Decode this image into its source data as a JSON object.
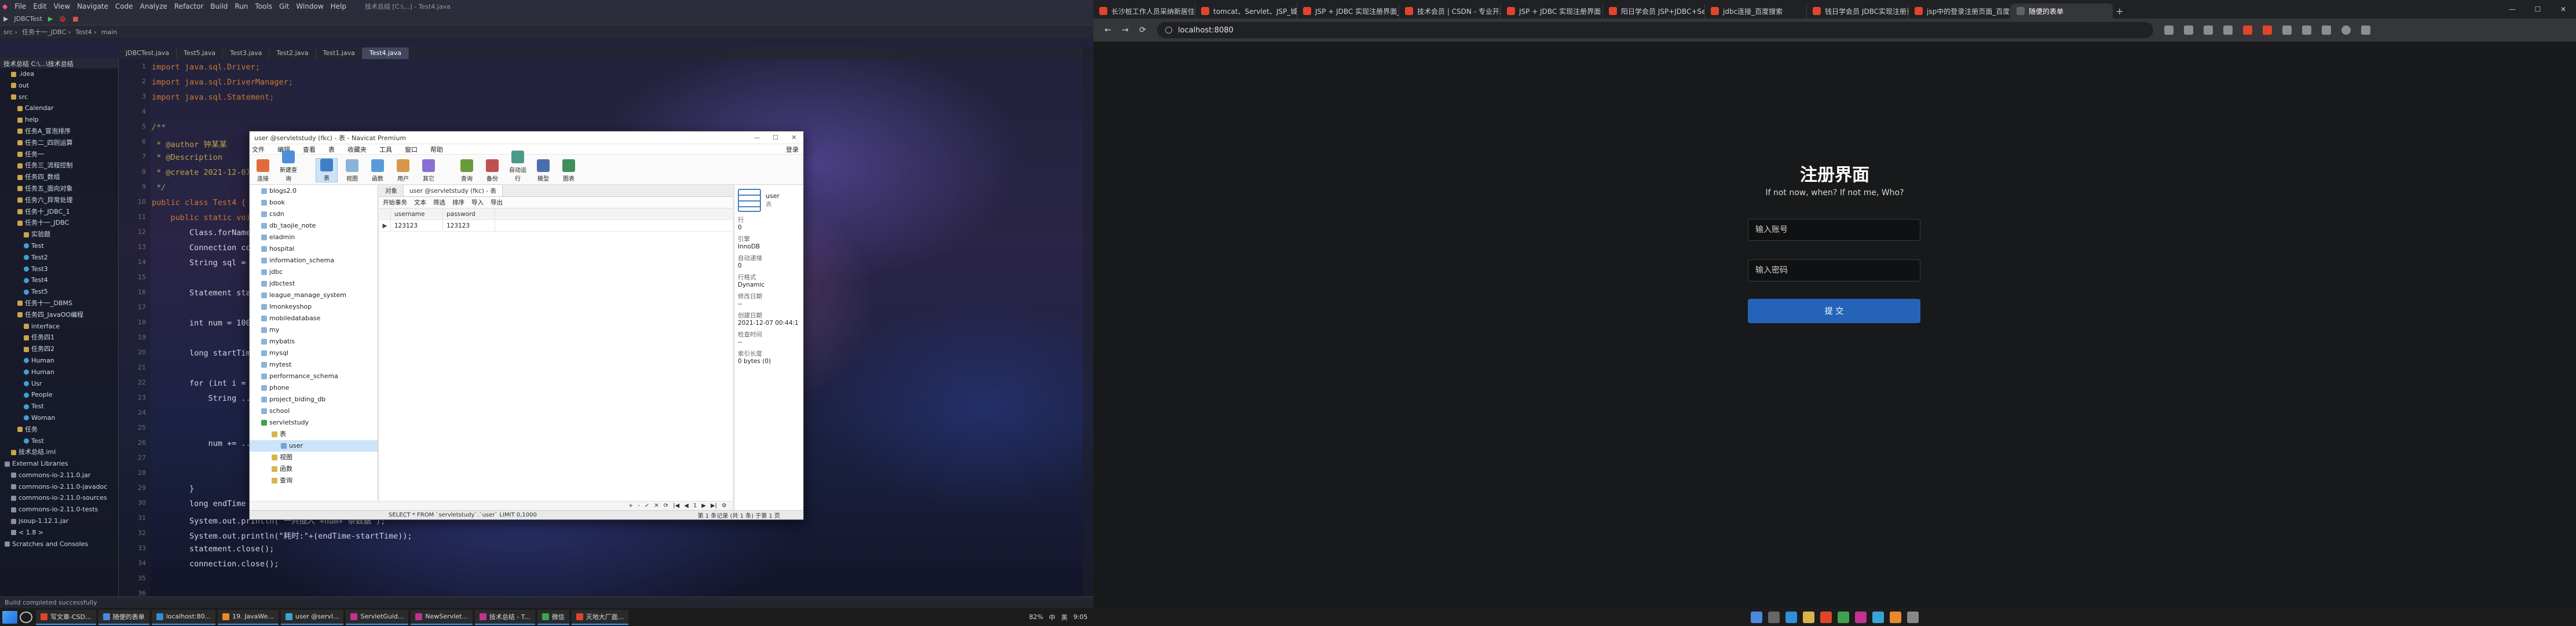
{
  "ide": {
    "menu": [
      "File",
      "Edit",
      "View",
      "Navigate",
      "Code",
      "Analyze",
      "Refactor",
      "Build",
      "Run",
      "Tools",
      "Git",
      "Window",
      "Help"
    ],
    "title": "技术总结 [C:\\...] - Test4.java",
    "toolbar_config": "JDBCTest",
    "breadcrumbs": [
      "src",
      "任务十一_JDBC",
      "Test4",
      "main"
    ],
    "editor_tabs": [
      "JDBCTest.java",
      "Test5.java",
      "Test3.java",
      "Test2.java",
      "Test1.java",
      "Test4.java"
    ],
    "active_tab": 5,
    "project_header": "技术总结 C:\\...\\技术总结",
    "tree": [
      ".idea",
      "out",
      "src",
      "Calendar",
      "help",
      "任务A_冒泡排序",
      "任务二_四则运算",
      "任务一",
      "任务三_流程控制",
      "任务四_数组",
      "任务五_面向对象",
      "任务六_异常处理",
      "任务十_JDBC_1",
      "任务十一_JDBC",
      "实验题",
      "Test",
      "Test2",
      "Test3",
      "Test4",
      "Test5",
      "任务十一_DBMS",
      "任务四_JavaOO编程",
      "interface",
      "任务四1",
      "任务四2",
      "Human",
      "Human",
      "Usr",
      "People",
      "Test",
      "Woman",
      "任务",
      "Test",
      "技术总结.iml",
      "External Libraries",
      "commons-io-2.11.0.jar",
      "commons-io-2.11.0-javadoc",
      "commons-io-2.11.0-sources",
      "commons-io-2.11.0-tests",
      "jsoup-1.12.1.jar",
      "< 1.8 >",
      "Scratches and Consoles"
    ],
    "code": [
      {
        "line": 1,
        "text": "import java.sql.Driver;"
      },
      {
        "line": 2,
        "text": "import java.sql.DriverManager;"
      },
      {
        "line": 3,
        "text": "import java.sql.Statement;"
      },
      {
        "line": 5,
        "text": "/**"
      },
      {
        "line": 6,
        "text": " * @author 钟某某"
      },
      {
        "line": 7,
        "text": " * @Description"
      },
      {
        "line": 8,
        "text": " * @create 2021-12-07"
      },
      {
        "line": 9,
        "text": " */"
      },
      {
        "line": 10,
        "text": "public class Test4 {"
      },
      {
        "line": 11,
        "text": "    public static void main(String[] args) throws Exception {"
      },
      {
        "line": 12,
        "text": "        Class.forName(\"com.mysql.cj.jdbc.Driver\");"
      },
      {
        "line": 13,
        "text": "        Connection connection = DriverManager.getConnection(url, user, password);"
      },
      {
        "line": 14,
        "text": "        String sql = \"...\";"
      },
      {
        "line": 16,
        "text": "        Statement statement = connection.createStatement();"
      },
      {
        "line": 18,
        "text": "        int num = 10000;"
      },
      {
        "line": 20,
        "text": "        long startTime = System.currentTimeMillis();"
      },
      {
        "line": 22,
        "text": "        for (int i = 0; i < num; i++) {"
      },
      {
        "line": 23,
        "text": "            String ..."
      },
      {
        "line": 26,
        "text": "            num += ..."
      },
      {
        "line": 29,
        "text": "        }"
      },
      {
        "line": 30,
        "text": "        long endTime = System.currentTimeMillis();"
      },
      {
        "line": 31,
        "text": "        System.out.println(\"一共插入\"+num+\"条数据\");"
      },
      {
        "line": 32,
        "text": "        System.out.println(\"耗时:\"+(endTime-startTime));"
      },
      {
        "line": 33,
        "text": "        statement.close();"
      },
      {
        "line": 34,
        "text": "        connection.close();"
      }
    ],
    "gutter_numbers": [
      "1",
      "2",
      "3",
      "4",
      "5",
      "6",
      "7",
      "8",
      "9",
      "10",
      "11",
      "12",
      "13",
      "14",
      "15",
      "16",
      "17",
      "18",
      "19",
      "20",
      "21",
      "22",
      "23",
      "24",
      "25",
      "26",
      "27",
      "28",
      "29",
      "30",
      "31",
      "32",
      "33",
      "34",
      "35",
      "36"
    ],
    "status": "Build completed successfully"
  },
  "navicat": {
    "title": "user @servletstudy (fkc) - 表 - Navicat Premium",
    "menu": [
      "文件",
      "编辑",
      "查看",
      "表",
      "收藏夹",
      "工具",
      "窗口",
      "帮助"
    ],
    "login_label": "登录",
    "ribbon": [
      "连接",
      "新建查询",
      "表",
      "视图",
      "函数",
      "用户",
      "其它",
      "查询",
      "备份",
      "自动运行",
      "模型",
      "图表"
    ],
    "selected_ribbon": 2,
    "databases": [
      "blogs2.0",
      "book",
      "csdn",
      "db_taojie_note",
      "eladmin",
      "hospital",
      "information_schema",
      "jdbc",
      "jdbctest",
      "league_manage_system",
      "lmonkeyshop",
      "mobiledatabase",
      "my",
      "mybatis",
      "mysql",
      "mytest",
      "performance_schema",
      "phone",
      "project_biding_db",
      "school"
    ],
    "open_db": "servletstudy",
    "open_children": [
      "表",
      "视图",
      "函数",
      "查询"
    ],
    "open_table": "user",
    "tabs": [
      "对象",
      "user @servletstudy (fkc) - 表"
    ],
    "grid_toolbar": [
      "开始事务",
      "文本",
      "筛选",
      "排序",
      "导入",
      "导出"
    ],
    "grid_headers": [
      "username",
      "password"
    ],
    "grid_rows": [
      [
        "123123",
        "123123"
      ]
    ],
    "grid_footer": [
      "+",
      "-",
      "✓",
      "✕",
      "⟳",
      "|◀",
      "◀",
      "1",
      "▶",
      "▶|",
      "⚙"
    ],
    "info_title": "user",
    "info_subtitle": "表",
    "info": [
      {
        "label": "行",
        "value": "0"
      },
      {
        "label": "引擎",
        "value": "InnoDB"
      },
      {
        "label": "自动递增",
        "value": "0"
      },
      {
        "label": "行格式",
        "value": "Dynamic"
      },
      {
        "label": "修改日期",
        "value": "--"
      },
      {
        "label": "创建日期",
        "value": "2021-12-07 00:44:1"
      },
      {
        "label": "检查时间",
        "value": "--"
      },
      {
        "label": "索引长度",
        "value": "0 bytes (0)"
      }
    ],
    "status_sql": "SELECT * FROM `servletstudy`.`user` LIMIT 0,1000",
    "status_right": "第 1 条记录 (共 1 条) 于第 1 页"
  },
  "taskbar1": {
    "items": [
      "写文章-CSD...",
      "随便的表单",
      "localhost:80...",
      "19. JavaWe...",
      "user @servl...",
      "ServletGuid...",
      "NewServlet...",
      "技术总结 - T...",
      "微信",
      "灭地大厂面..."
    ],
    "tray": [
      "82%",
      "中",
      "英",
      "9:05"
    ]
  },
  "browser": {
    "tabs": [
      "长沙桩工作人员采纳新居住区/长...",
      "tomcat、Servlet、JSP_城域网...",
      "JSP + JDBC 实现注册界面_我们...",
      "技术会员 | CSDN - 专业开发...",
      "JSP + JDBC 实现注册界面 - CS...",
      "阳日学会员 JSP+JDBC+Servlet...",
      "jdbc连接_百度搜索",
      "钱日学会员 JDBC实现注册页...",
      "jsp中的登录注册页面_百度搜索",
      "随便的表单"
    ],
    "active_tab": 9,
    "url": "localhost:8080",
    "window_controls": [
      "—",
      "☐",
      "✕"
    ]
  },
  "register": {
    "title": "注册界面",
    "subtitle": "If not now,  when? If not me,  Who?",
    "account_placeholder": "输入账号",
    "password_placeholder": "输入密码",
    "submit_label": "提 交",
    "accent": "#2563b8"
  }
}
